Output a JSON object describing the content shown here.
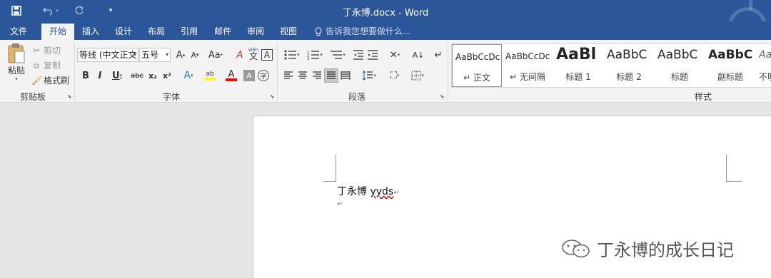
{
  "titlebar": {
    "title": "丁永博.docx - Word",
    "save_icon": "save-icon",
    "undo_icon": "undo-icon",
    "redo_icon": "redo-icon",
    "customize_icon": "customize-qat-icon"
  },
  "tabs": [
    {
      "label": "文件"
    },
    {
      "label": "开始",
      "active": true
    },
    {
      "label": "插入"
    },
    {
      "label": "设计"
    },
    {
      "label": "布局"
    },
    {
      "label": "引用"
    },
    {
      "label": "邮件"
    },
    {
      "label": "审阅"
    },
    {
      "label": "视图"
    }
  ],
  "tellme": {
    "text": "告诉我您想要做什么..."
  },
  "clipboard": {
    "paste": "粘贴",
    "cut": "剪切",
    "copy": "复制",
    "format_painter": "格式刷",
    "group_label": "剪贴板"
  },
  "font": {
    "family": "等线 (中文正文",
    "size": "五号",
    "grow": "A",
    "shrink": "A",
    "change_case": "Aa",
    "clear_format": "A",
    "phonetic": "wén",
    "phonetic_char": "文",
    "char_border": "A",
    "bold": "B",
    "italic": "I",
    "underline": "U",
    "strike": "abc",
    "subscript": "x₂",
    "superscript": "x²",
    "text_effect": "A",
    "highlight": "ab",
    "font_color": "A",
    "char_shading": "A",
    "enclose": "字",
    "group_label": "字体"
  },
  "paragraph": {
    "group_label": "段落"
  },
  "styles": {
    "group_label": "样式",
    "items": [
      {
        "preview": "AaBbCcDc",
        "name": "↵ 正文"
      },
      {
        "preview": "AaBbCcDc",
        "name": "↵ 无间隔"
      },
      {
        "preview": "AaBl",
        "name": "标题 1"
      },
      {
        "preview": "AaBbC",
        "name": "标题 2"
      },
      {
        "preview": "AaBbC",
        "name": "标题"
      },
      {
        "preview": "AaBbC",
        "name": "副标题"
      },
      {
        "preview": "Aa",
        "name": "不明"
      }
    ]
  },
  "document": {
    "line1_text": "丁永博 ",
    "line1_misspelled": "yyds",
    "para_mark": "↵"
  },
  "watermark": {
    "text": "丁永博的成长日记"
  },
  "colors": {
    "accent": "#2b579a",
    "highlight": "#ffff00",
    "font_color": "#ff0000"
  }
}
